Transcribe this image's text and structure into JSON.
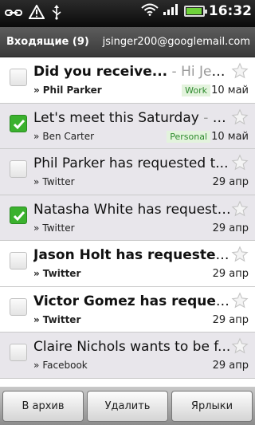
{
  "status_bar": {
    "time": "16:32",
    "icons": [
      "usb-link-icon",
      "warning-icon",
      "usb-icon",
      "wifi-icon",
      "signal-icon",
      "battery-icon"
    ],
    "battery_level": 0.85,
    "battery_color": "#6ed13a"
  },
  "header": {
    "title": "Входящие (9)",
    "account": "jsinger200@googlemail.com"
  },
  "messages": [
    {
      "subject": "Did you receive...",
      "snippet": " - Hi Jenn, ...",
      "sender": "Phil Parker",
      "label": "Work",
      "date": "10 май",
      "unread": true,
      "checked": false
    },
    {
      "subject": "Let's meet this Saturday",
      "snippet": " - Hi J...",
      "sender": "Ben Carter",
      "label": "Personal",
      "date": "10 май",
      "unread": false,
      "checked": true
    },
    {
      "subject": "Phil Parker has requested t...",
      "snippet": "",
      "sender": "Twitter",
      "label": "",
      "date": "29 апр",
      "unread": false,
      "checked": false
    },
    {
      "subject": "Natasha White has requeste...",
      "snippet": "",
      "sender": "Twitter",
      "label": "",
      "date": "29 апр",
      "unread": false,
      "checked": true
    },
    {
      "subject": "Jason Holt has requested ...",
      "snippet": "",
      "sender": "Twitter",
      "label": "",
      "date": "29 апр",
      "unread": true,
      "checked": false
    },
    {
      "subject": "Victor Gomez has request...",
      "snippet": "",
      "sender": "Twitter",
      "label": "",
      "date": "29 апр",
      "unread": true,
      "checked": false
    },
    {
      "subject": "Claire Nichols wants to be f...",
      "snippet": "",
      "sender": "Facebook",
      "label": "",
      "date": "29 апр",
      "unread": false,
      "checked": false
    }
  ],
  "sender_prefix": "»",
  "bottom_bar": {
    "archive_label": "В архив",
    "delete_label": "Удалить",
    "labels_label": "Ярлыки"
  },
  "colors": {
    "checked": "#3bb12e",
    "read_row": "#e8e6eb",
    "label_bg": "#e3f3dd",
    "label_text": "#2e8b2e"
  }
}
